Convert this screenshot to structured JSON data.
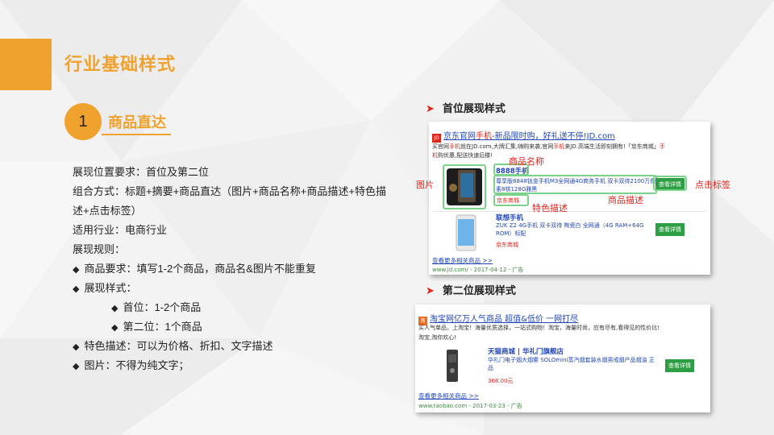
{
  "slide": {
    "title": "行业基础样式",
    "section_number": "1",
    "section_title": "商品直达"
  },
  "description": {
    "lines": [
      "展现位置要求：首位及第二位",
      "组合方式：标题+摘要+商品直达（图片+商品名称+商品描述+特色描",
      "述+点击标签）",
      "适用行业：电商行业",
      "展现规则："
    ],
    "bullets": [
      "商品要求：填写1-2个商品，商品名&图片不能重复",
      "展现样式：",
      "首位：1-2个商品",
      "第二位：1个商品",
      "特色描述：可以为价格、折扣、文字描述",
      "图片：不得为纯文字；"
    ]
  },
  "first_position": {
    "heading": "首位展现样式",
    "ad_title_prefix": "京东官网",
    "ad_title_red": "手机",
    "ad_title_suffix": "-新品限时购，好礼送不停!JD.com",
    "summary_a": "买官网",
    "summary_a_red": "手机",
    "summary_b": "就在JD.com,大牌汇集,嗨购来袭,官网",
    "summary_b_red": "手机",
    "summary_c": "来JD.高端生活即刻拥有!「京东商城」",
    "summary_c_red": "手",
    "summary_line2_red": "机",
    "summary_line2": "购优惠,配送快速后楼!",
    "product1": {
      "name": "8888手机",
      "desc": "尊享版8848钛金手机M3全网通4G商务手机 双卡双待2100万像素8核128G雅黑",
      "feature": "京东商城",
      "button": "查看详情"
    },
    "product2": {
      "name": "联想手机",
      "desc": "ZUK Z2 4G手机 双卡双待 陶瓷白 全网通（4G RAM+64G ROM）标配",
      "feature": "京东商城",
      "button": "查看详情"
    },
    "more_link": "查看更多相关商品 >>",
    "footer": "www.jd.com/ - 2017-04-12 - 广告",
    "annotations": {
      "name": "商品名称",
      "image": "图片",
      "click": "点击标签",
      "desc": "商品描述",
      "feature": "特色描述"
    }
  },
  "second_position": {
    "heading": "第二位展现样式",
    "ad_title": "淘宝网亿万人气商品 超值&低价 一网打尽",
    "summary1": "买人气单品，上淘宝！海量优质选择，一站式购物！淘宝，海量时尚，应有尽有,看得见的性价比!",
    "summary2": "淘宝,淘你欢心!",
    "product": {
      "name": "天猫商城 | 华礼门旗舰店",
      "desc": "华礼门电子烟大烟雾 SOLOmini蒸汽烟套装水烟男戒烟产品烟油 正品",
      "price": "368.00元",
      "button": "查看详情"
    },
    "more_link": "查看更多相关商品 >>",
    "footer": "www.taobao.com - 2017-03-23 - 广告"
  },
  "colors": {
    "accent": "#f0a22e",
    "red": "#e2231a",
    "link": "#2147b8",
    "button_green": "#2e9e44",
    "highlight_green": "#7bd38a"
  }
}
